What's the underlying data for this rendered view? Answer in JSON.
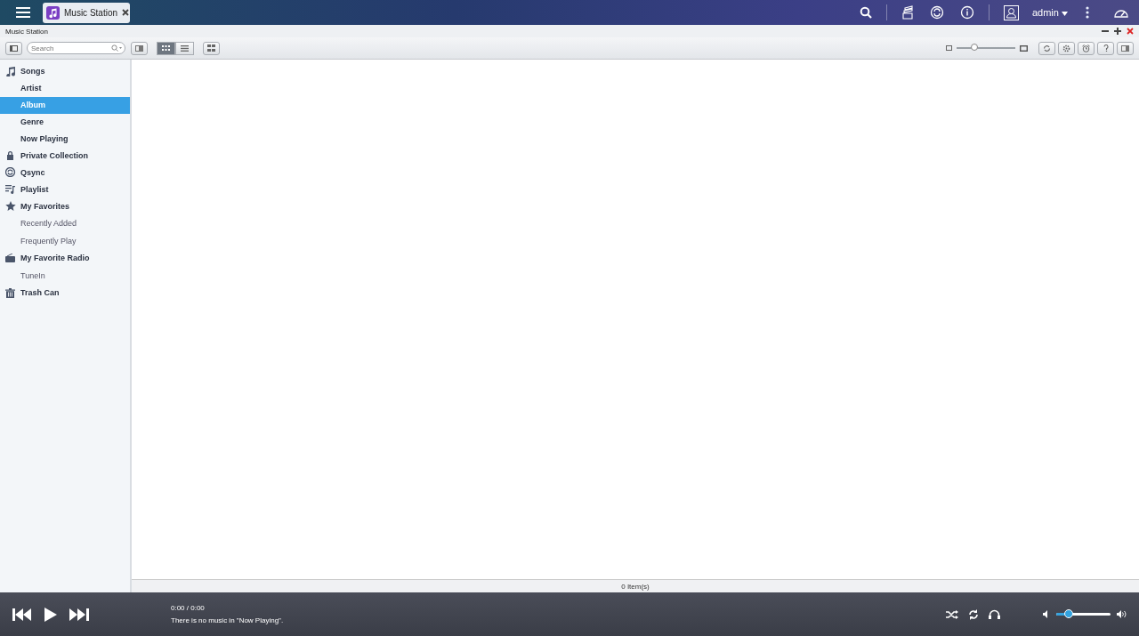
{
  "taskbar": {
    "tab": {
      "label": "Music Station"
    },
    "user": "admin"
  },
  "window": {
    "title": "Music Station"
  },
  "toolbar": {
    "search": {
      "placeholder": "Search"
    },
    "view_modes": [
      {
        "kind": "grid",
        "selected": true
      },
      {
        "kind": "list",
        "selected": false
      }
    ],
    "zoom": {
      "level": 0.3
    }
  },
  "sidebar": {
    "items": [
      {
        "label": "Songs",
        "kind": "note",
        "selected": false,
        "children": [
          {
            "label": "Artist",
            "emphasis": true,
            "selected": false
          },
          {
            "label": "Album",
            "emphasis": true,
            "selected": true
          },
          {
            "label": "Genre",
            "emphasis": true,
            "selected": false
          },
          {
            "label": "Now Playing",
            "emphasis": true,
            "selected": false
          }
        ]
      },
      {
        "label": "Private Collection",
        "kind": "lock",
        "selected": false
      },
      {
        "label": "Qsync",
        "kind": "sync",
        "selected": false
      },
      {
        "label": "Playlist",
        "kind": "playlist",
        "selected": false
      },
      {
        "label": "My Favorites",
        "kind": "star",
        "selected": false,
        "children": [
          {
            "label": "Recently Added",
            "emphasis": false,
            "selected": false
          },
          {
            "label": "Frequently Play",
            "emphasis": false,
            "selected": false
          }
        ]
      },
      {
        "label": "My Favorite Radio",
        "kind": "radio",
        "selected": false,
        "children": [
          {
            "label": "TuneIn",
            "emphasis": false,
            "selected": false
          }
        ]
      },
      {
        "label": "Trash Can",
        "kind": "trash",
        "selected": false
      }
    ]
  },
  "status_bar": {
    "count": "0 Item(s)"
  },
  "player": {
    "time": "0:00 / 0:00",
    "message": "There is no music in \"Now Playing\".",
    "volume": {
      "level": 0.23
    }
  }
}
